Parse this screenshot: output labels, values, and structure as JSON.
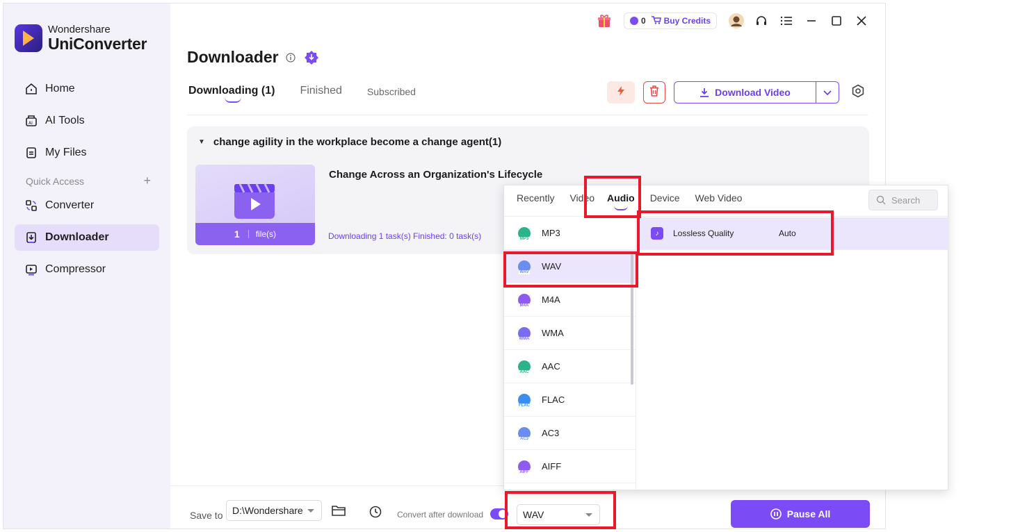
{
  "brand": {
    "small": "Wondershare",
    "big": "UniConverter"
  },
  "sidebar": {
    "items": [
      {
        "label": "Home",
        "icon": "home-icon"
      },
      {
        "label": "AI Tools",
        "icon": "ai-tools-icon"
      },
      {
        "label": "My Files",
        "icon": "my-files-icon"
      }
    ],
    "quick_access": "Quick Access",
    "quick_items": [
      {
        "label": "Converter",
        "icon": "converter-icon"
      },
      {
        "label": "Downloader",
        "icon": "downloader-icon",
        "active": true
      },
      {
        "label": "Compressor",
        "icon": "compressor-icon"
      }
    ]
  },
  "titlebar": {
    "credits_count": "0",
    "buy_credits": "Buy Credits"
  },
  "page": {
    "title": "Downloader"
  },
  "tabs": [
    {
      "label": "Downloading (1)",
      "active": true
    },
    {
      "label": "Finished"
    },
    {
      "label": "Subscribed"
    }
  ],
  "toolbar": {
    "download_label": "Download Video"
  },
  "group": {
    "title": "change agility in the workplace become a change agent(1)",
    "item_title": "Change Across an Organization's Lifecycle",
    "file_count": "1",
    "file_label": "file(s)",
    "status": "Downloading 1 task(s) Finished: 0 task(s)"
  },
  "popup": {
    "tabs": [
      "Recently",
      "Video",
      "Audio",
      "Device",
      "Web Video"
    ],
    "active_tab": "Audio",
    "search_placeholder": "Search",
    "formats": [
      {
        "name": "MP3",
        "color": "#2bb38a"
      },
      {
        "name": "WAV",
        "color": "#6b8cf0",
        "selected": true
      },
      {
        "name": "M4A",
        "color": "#8e5cf0"
      },
      {
        "name": "WMA",
        "color": "#7a6cf0"
      },
      {
        "name": "AAC",
        "color": "#2bb38a"
      },
      {
        "name": "FLAC",
        "color": "#3a8ef0"
      },
      {
        "name": "AC3",
        "color": "#6b8cf0"
      },
      {
        "name": "AIFF",
        "color": "#8e5cf0"
      }
    ],
    "quality": {
      "label": "Lossless Quality",
      "value": "Auto"
    }
  },
  "bottom": {
    "save_to": "Save to",
    "path": "D:\\Wondershare",
    "convert_after": "Convert after download",
    "format_value": "WAV",
    "pause_all": "Pause All"
  },
  "colors": {
    "accent": "#7b4cf5",
    "highlight": "#e8192b"
  }
}
